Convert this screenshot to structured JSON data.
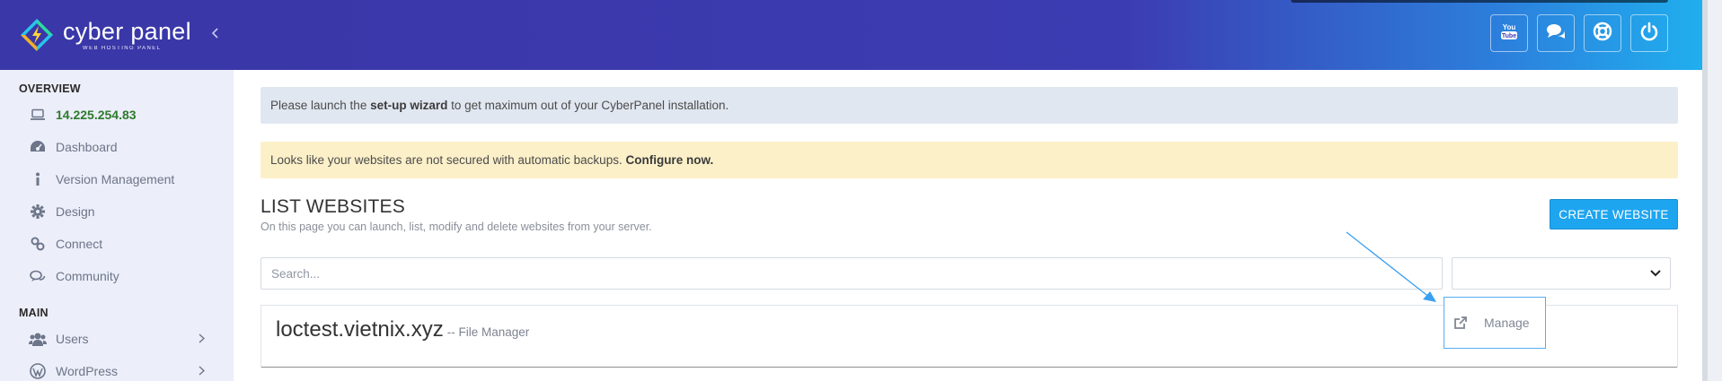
{
  "brand": {
    "name": "cyber panel",
    "tagline": "WEB HOSTING PANEL",
    "colors": {
      "primary": "#3a37a8",
      "accent": "#1ea5f0"
    }
  },
  "sidebar": {
    "overview_header": "OVERVIEW",
    "ip_address": "14.225.254.83",
    "overview_items": [
      {
        "label": "Dashboard",
        "icon": "dashboard-icon"
      },
      {
        "label": "Version Management",
        "icon": "info-icon"
      },
      {
        "label": "Design",
        "icon": "gear-icon"
      },
      {
        "label": "Connect",
        "icon": "link-icon"
      },
      {
        "label": "Community",
        "icon": "chat-icon"
      }
    ],
    "main_header": "MAIN",
    "main_items": [
      {
        "label": "Users",
        "icon": "users-icon"
      },
      {
        "label": "WordPress",
        "icon": "wordpress-icon"
      }
    ]
  },
  "topbar": {
    "buttons": [
      {
        "label": "YouTube",
        "icon": "youtube-icon"
      },
      {
        "label": "Chat",
        "icon": "comments-icon"
      },
      {
        "label": "Support",
        "icon": "lifebuoy-icon"
      },
      {
        "label": "Logout",
        "icon": "power-icon"
      }
    ]
  },
  "alerts": {
    "setup_prefix": "Please launch the ",
    "setup_link": "set-up wizard",
    "setup_suffix": " to get maximum out of your CyberPanel installation.",
    "backup_text": "Looks like your websites are not secured with automatic backups. ",
    "backup_link": "Configure now."
  },
  "list_websites": {
    "title": "LIST WEBSITES",
    "subtitle": "On this page you can launch, list, modify and delete websites from your server.",
    "create_button": "CREATE WEBSITE",
    "search_placeholder": "Search...",
    "filter_value": ""
  },
  "website": {
    "domain": "loctest.vietnix.xyz",
    "file_manager": "-- File Manager",
    "manage_button": "Manage"
  }
}
